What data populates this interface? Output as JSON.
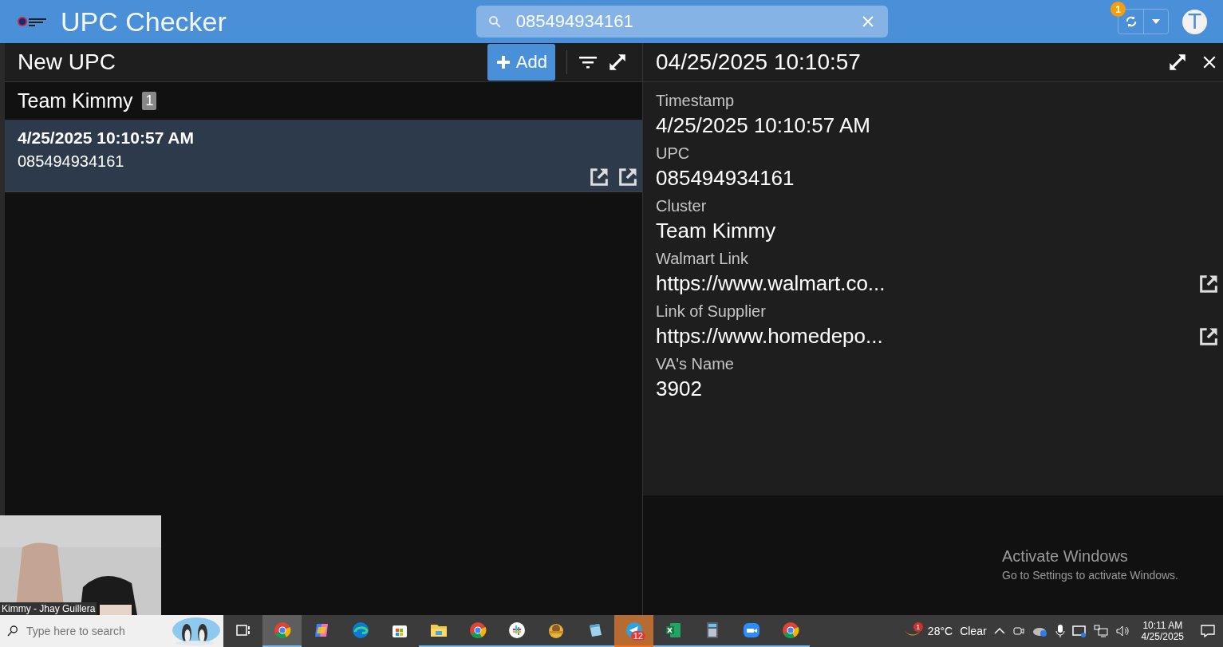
{
  "app_bar": {
    "title": "UPC Checker",
    "search": {
      "value": "085494934161"
    },
    "sync_badge": "1",
    "avatar": "T"
  },
  "list_panel": {
    "title": "New UPC",
    "add_label": "Add",
    "group": {
      "name": "Team Kimmy",
      "count": "1"
    },
    "items": [
      {
        "timestamp": "4/25/2025 10:10:57 AM",
        "upc": "085494934161",
        "selected": true
      }
    ]
  },
  "detail_panel": {
    "title": "04/25/2025 10:10:57",
    "fields": [
      {
        "label": "Timestamp",
        "value": "4/25/2025 10:10:57 AM",
        "kind": "text"
      },
      {
        "label": "UPC",
        "value": "085494934161",
        "kind": "text"
      },
      {
        "label": "Cluster",
        "value": "Team Kimmy",
        "kind": "text"
      },
      {
        "label": "Walmart Link",
        "value": "https://www.walmart.co...",
        "kind": "link"
      },
      {
        "label": "Link of Supplier",
        "value": "https://www.homedepo...",
        "kind": "link"
      },
      {
        "label": "VA's Name",
        "value": "3902",
        "kind": "text"
      }
    ]
  },
  "video_overlay": {
    "caption": "Kimmy - Jhay Guillera"
  },
  "taskbar": {
    "search_placeholder": "Type here to search",
    "apps": [
      {
        "kind": "task-view",
        "selected": false,
        "running": false,
        "flashing": false
      },
      {
        "kind": "chrome",
        "selected": true,
        "running": true,
        "flashing": false
      },
      {
        "kind": "copilot",
        "selected": false,
        "running": false,
        "flashing": false
      },
      {
        "kind": "edge",
        "selected": false,
        "running": false,
        "flashing": false
      },
      {
        "kind": "store",
        "selected": false,
        "running": false,
        "flashing": false
      },
      {
        "kind": "explorer",
        "selected": false,
        "running": true,
        "flashing": false
      },
      {
        "kind": "chrome",
        "selected": false,
        "running": true,
        "flashing": false
      },
      {
        "kind": "slack",
        "selected": false,
        "running": true,
        "flashing": false
      },
      {
        "kind": "bear",
        "selected": false,
        "running": true,
        "flashing": false
      },
      {
        "kind": "notepad",
        "selected": false,
        "running": true,
        "flashing": false
      },
      {
        "kind": "telegram",
        "selected": false,
        "running": true,
        "flashing": true,
        "badge": "12"
      },
      {
        "kind": "excel",
        "selected": false,
        "running": true,
        "flashing": false
      },
      {
        "kind": "calculator",
        "selected": false,
        "running": true,
        "flashing": false
      },
      {
        "kind": "zoom",
        "selected": false,
        "running": true,
        "flashing": false
      },
      {
        "kind": "chrome",
        "selected": false,
        "running": true,
        "flashing": false
      }
    ],
    "weather": {
      "badge": "1",
      "temperature": "28°C",
      "condition": "Clear"
    },
    "clock": {
      "time": "10:11 AM",
      "date": "4/25/2025"
    }
  },
  "watermark": {
    "title": "Activate Windows",
    "subtitle": "Go to Settings to activate Windows."
  }
}
